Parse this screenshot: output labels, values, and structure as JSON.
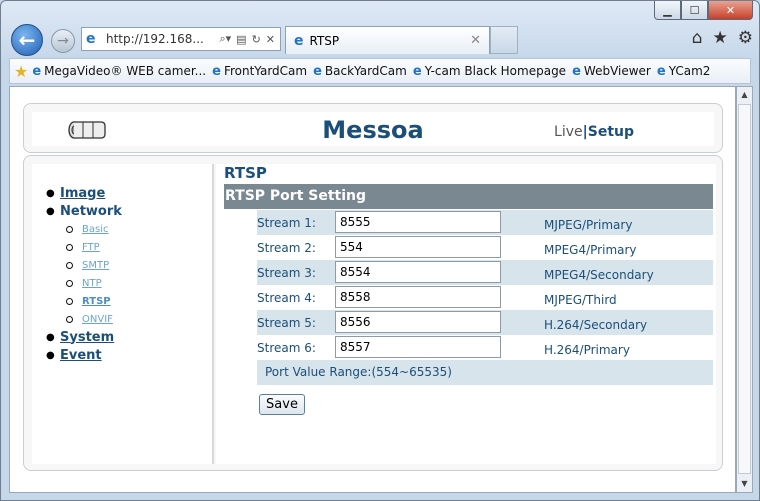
{
  "browser": {
    "address": "http://192.168...",
    "tab_title": "RTSP",
    "favorites": [
      "MegaVideo® WEB camer...",
      "FrontYardCam",
      "BackYardCam",
      "Y-cam Black Homepage",
      "WebViewer",
      "YCam2"
    ]
  },
  "header": {
    "brand": "Messoa",
    "live": "Live",
    "separator": "|",
    "setup": "Setup"
  },
  "sidebar": {
    "items": [
      {
        "label": "Image"
      },
      {
        "label": "Network"
      },
      {
        "label": "System"
      },
      {
        "label": "Event"
      }
    ],
    "network_sub": [
      "Basic",
      "FTP",
      "SMTP",
      "NTP",
      "RTSP",
      "ONVIF"
    ]
  },
  "main": {
    "title": "RTSP",
    "section": "RTSP Port Setting",
    "streams": [
      {
        "label": "Stream 1:",
        "value": "8555",
        "format": "MJPEG/Primary"
      },
      {
        "label": "Stream 2:",
        "value": "554",
        "format": "MPEG4/Primary"
      },
      {
        "label": "Stream 3:",
        "value": "8554",
        "format": "MPEG4/Secondary"
      },
      {
        "label": "Stream 4:",
        "value": "8558",
        "format": "MJPEG/Third"
      },
      {
        "label": "Stream 5:",
        "value": "8556",
        "format": "H.264/Secondary"
      },
      {
        "label": "Stream 6:",
        "value": "8557",
        "format": "H.264/Primary"
      }
    ],
    "range": "Port Value Range:(554~65535)",
    "save": "Save"
  }
}
